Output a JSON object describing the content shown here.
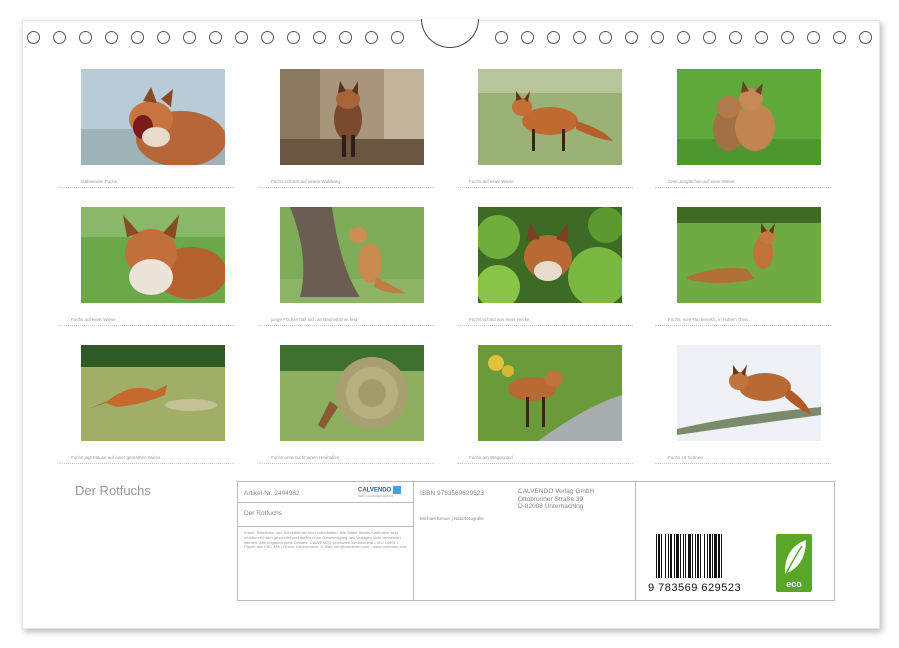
{
  "calendar_title": "Der Rotfuchs",
  "photos": [
    {
      "caption": "Gähnender Fuchs"
    },
    {
      "caption": "Fuchs schnürt auf einem Waldweg"
    },
    {
      "caption": "Fuchs auf einer Wiese"
    },
    {
      "caption": "Zwei Jungfüchse auf einer Wiese"
    },
    {
      "caption": "Fuchs auf einer Wiese"
    },
    {
      "caption": "junge Füchse hält sich an Baumstamm fest"
    },
    {
      "caption": "Fuchs schaut aus einer Hecke"
    },
    {
      "caption": "Fuchs, vom Tau benetzt, in hohem Gras"
    },
    {
      "caption": "Fuchs jagt Mäuse auf einer gemähten Wiese"
    },
    {
      "caption": "Fuchs untersucht einen Heuballen"
    },
    {
      "caption": "Fuchs am Wegesrand"
    },
    {
      "caption": "Fuchs im Schnee"
    }
  ],
  "info": {
    "article_no": "Artikel-Nr. 2404982",
    "brand": "CALVENDO",
    "brand_sub": "DER KALENDERVERLAG",
    "product_title": "Der Rotfuchs",
    "legal_text": "Irrtum, Satzfehler und Schreibfehler sind vorbehalten. Alle Bilder dieses Kalenders sind urheberrechtlich geschützt und dürfen ohne Genehmigung des Verlages nicht verwendet werden. Alle Angaben ohne Gewähr. CALVENDO produziert klimaneutral • ISO 14001 • Papier aus FSC-Mix • Druck: Deutschland. E-Mail: info@calvendo.com • www.calvendo.com",
    "isbn": "ISBN 9783569629523",
    "author": "Michael Breuer | Naturfotografie",
    "publisher": [
      "CALVENDO Verlag GmbH",
      "Ottobrunner Straße 39",
      "D-82008 Unterhaching"
    ],
    "barcode_digits": "9 783569 629523",
    "eco_label": "eco"
  }
}
